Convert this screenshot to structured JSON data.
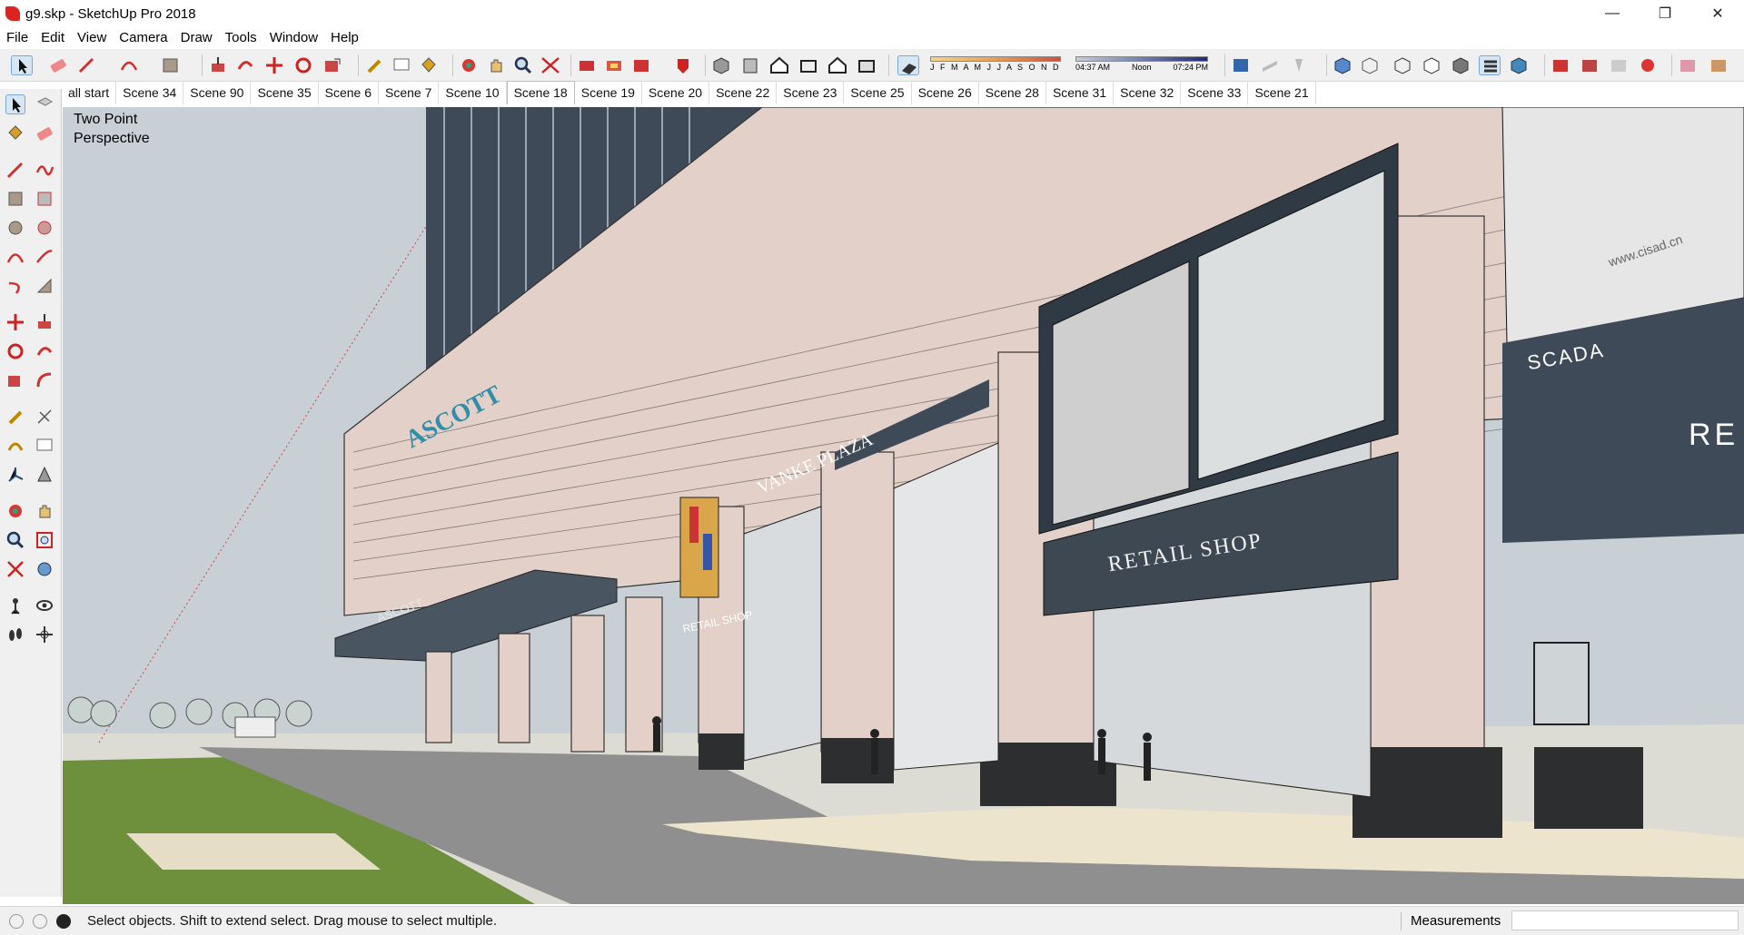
{
  "window": {
    "title": "g9.skp - SketchUp Pro 2018",
    "min_glyph": "—",
    "max_glyph": "❐",
    "close_glyph": "✕"
  },
  "menu": [
    "File",
    "Edit",
    "View",
    "Camera",
    "Draw",
    "Tools",
    "Window",
    "Help"
  ],
  "shadow": {
    "months": "J F M A M J J A S O N D",
    "time_start": "04:37 AM",
    "time_noon": "Noon",
    "time_end": "07:24 PM"
  },
  "scenes": [
    "all start",
    "Scene 34",
    "Scene 90",
    "Scene 35",
    "Scene 6",
    "Scene 7",
    "Scene 10",
    "Scene 18",
    "Scene 19",
    "Scene 20",
    "Scene 22",
    "Scene 23",
    "Scene 25",
    "Scene 26",
    "Scene 28",
    "Scene 31",
    "Scene 32",
    "Scene 33",
    "Scene 21"
  ],
  "active_scene": "Scene 18",
  "viewport": {
    "camera_line1": "Two Point",
    "camera_line2": "Perspective",
    "signs": {
      "ascott": "ASCOTT",
      "ascott_small": "ASCOTT",
      "vanke": "VANKE PLAZA",
      "retail_main": "RETAIL SHOP",
      "retail_small": "RETAIL SHOP",
      "scada": "SCADA",
      "re": "RE",
      "watermark": "www.cisad.cn"
    }
  },
  "status": {
    "hint": "Select objects. Shift to extend select. Drag mouse to select multiple.",
    "measurements_label": "Measurements",
    "measurements_value": ""
  },
  "colors": {
    "stone": "#e6d3cc",
    "glass_dark": "#3b4652",
    "canopy": "#4a5562",
    "sky": "#c9d1d6",
    "grass": "#6e8f3c",
    "road": "#8c8c8c"
  }
}
